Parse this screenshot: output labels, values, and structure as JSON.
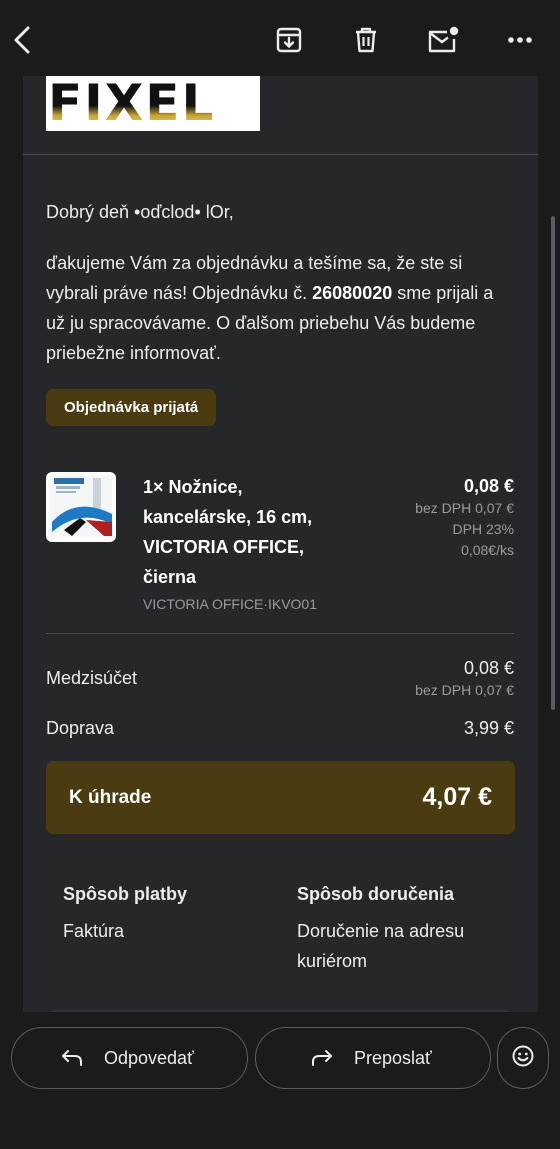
{
  "toolbar": {
    "back_icon": "back-arrow-icon",
    "archive_icon": "archive-icon",
    "delete_icon": "trash-icon",
    "mark_unread_icon": "mail-unread-icon",
    "more_icon": "more-horizontal-icon"
  },
  "email": {
    "logo_text": "FIXEL",
    "greeting": "Dobrý deň •oďclod• lOr,",
    "message_part1": "ďakujeme Vám za objednávku a tešíme sa, že ste si vybrali práve nás! Objednávku č. ",
    "order_number": "26080020",
    "message_part2": " sme prijali a už ju spracovávame. O ďalšom priebehu Vás budeme priebežne informovať.",
    "status_badge": "Objednávka prijatá",
    "item": {
      "name": "1× Nožnice, kancelárske, 16 cm, VICTORIA OFFICE, čierna",
      "sku": "VICTORIA OFFICE·IKVO01",
      "price": "0,08 €",
      "price_excl_vat": "bez DPH 0,07 €",
      "vat": "DPH 23%",
      "unit_price": "0,08€/ks"
    },
    "subtotal": {
      "label": "Medzisúčet",
      "value": "0,08 €",
      "excl_vat": "bez DPH 0,07 €"
    },
    "shipping": {
      "label": "Doprava",
      "value": "3,99 €"
    },
    "total": {
      "label": "K úhrade",
      "value": "4,07 €"
    },
    "payment": {
      "title": "Spôsob platby",
      "value": "Faktúra"
    },
    "delivery": {
      "title": "Spôsob doručenia",
      "value": "Doručenie na adresu kuriérom"
    }
  },
  "actions": {
    "reply_label": "Odpovedať",
    "forward_label": "Preposlať",
    "reply_icon": "reply-icon",
    "forward_icon": "forward-icon",
    "emoji_icon": "emoji-icon"
  },
  "colors": {
    "background": "#1b1b1b",
    "card": "#26272b",
    "accent_gold": "#4a3c10",
    "muted_text": "#9a9ba0"
  }
}
